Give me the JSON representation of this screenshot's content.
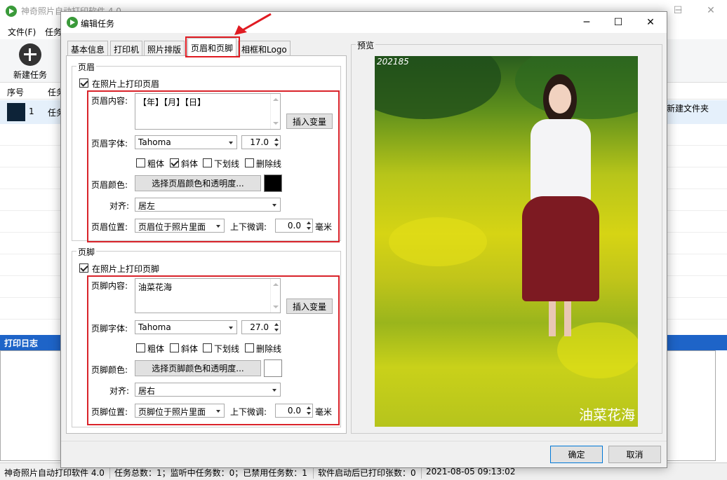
{
  "main_window": {
    "title": "神奇照片自动打印软件 4.0",
    "menu": [
      "文件(F)",
      "任务"
    ],
    "toolbar": {
      "new_task_label": "新建任务"
    },
    "table": {
      "headers": [
        "序号",
        "任务"
      ],
      "row": {
        "index": "1",
        "task": "任务",
        "folder": "新建文件夹"
      }
    },
    "log_title": "打印日志",
    "status": [
      "神奇照片自动打印软件 4.0",
      "任务总数：1；监听中任务数：0；已禁用任务数：1",
      "软件启动后已打印张数：0",
      "2021-08-05 09:13:02"
    ]
  },
  "dialog": {
    "title": "编辑任务",
    "tabs": [
      "基本信息",
      "打印机",
      "照片排版",
      "页眉和页脚",
      "相框和Logo"
    ],
    "active_tab": "页眉和页脚",
    "header": {
      "group_title": "页眉",
      "enable_label": "在照片上打印页眉",
      "enabled": true,
      "content_label": "页眉内容:",
      "content_value": "【年】【月】【日】",
      "insert_var_label": "插入变量",
      "font_label": "页眉字体:",
      "font_value": "Tahoma",
      "size_value": "17.0",
      "bold_label": "粗体",
      "bold": false,
      "italic_label": "斜体",
      "italic": true,
      "underline_label": "下划线",
      "underline": false,
      "strike_label": "删除线",
      "strike": false,
      "color_label": "页眉颜色:",
      "color_button_label": "选择页眉颜色和透明度...",
      "color_value": "#000000",
      "align_label": "对齐:",
      "align_value": "居左",
      "position_label": "页眉位置:",
      "position_value": "页眉位于照片里面",
      "offset_label": "上下微调:",
      "offset_value": "0.0",
      "unit_label": "毫米"
    },
    "footer": {
      "group_title": "页脚",
      "enable_label": "在照片上打印页脚",
      "enabled": true,
      "content_label": "页脚内容:",
      "content_value": "油菜花海",
      "insert_var_label": "插入变量",
      "font_label": "页脚字体:",
      "font_value": "Tahoma",
      "size_value": "27.0",
      "bold_label": "粗体",
      "bold": false,
      "italic_label": "斜体",
      "italic": false,
      "underline_label": "下划线",
      "underline": false,
      "strike_label": "删除线",
      "strike": false,
      "color_label": "页脚颜色:",
      "color_button_label": "选择页脚颜色和透明度...",
      "color_value": "#ffffff",
      "align_label": "对齐:",
      "align_value": "居右",
      "position_label": "页脚位置:",
      "position_value": "页脚位于照片里面",
      "offset_label": "上下微调:",
      "offset_value": "0.0",
      "unit_label": "毫米"
    },
    "preview": {
      "title": "预览",
      "header_text": "202185",
      "footer_text": "油菜花海"
    },
    "ok_label": "确定",
    "cancel_label": "取消"
  },
  "colors": {
    "highlight_red": "#e01b22",
    "log_header_blue": "#1e64c8"
  }
}
